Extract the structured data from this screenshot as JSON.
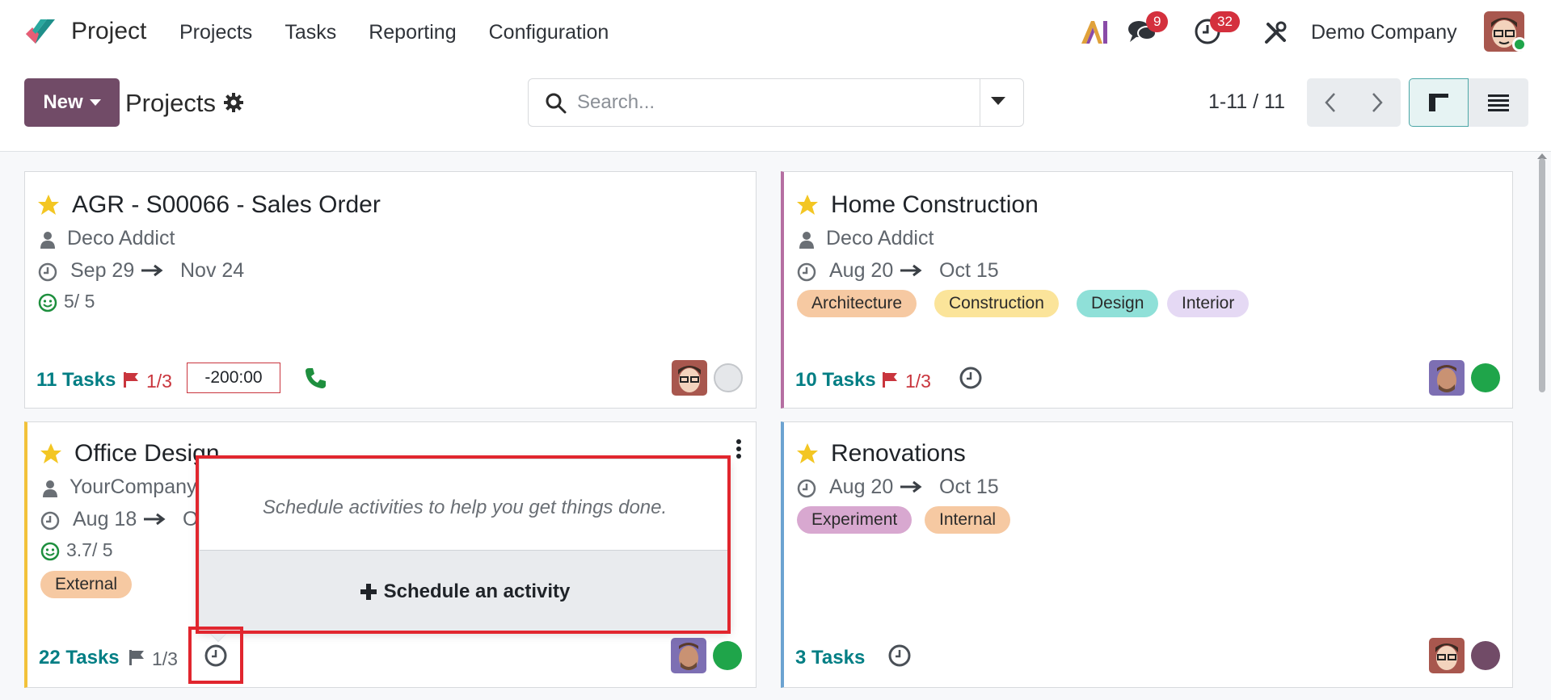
{
  "app": {
    "name": "Project"
  },
  "nav": {
    "items": [
      "Projects",
      "Tasks",
      "Reporting",
      "Configuration"
    ]
  },
  "systray": {
    "ai_label": "AI",
    "messages_count": "9",
    "activities_count": "32",
    "company": "Demo Company"
  },
  "control": {
    "new_label": "New",
    "breadcrumb": "Projects",
    "search_placeholder": "Search...",
    "pager": "1-11 / 11"
  },
  "cards": [
    {
      "title": "AGR - S00066 - Sales Order",
      "customer": "Deco Addict",
      "date_start": "Sep 29",
      "date_end": "Nov 24",
      "rating": "5/ 5",
      "tasks_count": "11",
      "tasks_label": "Tasks",
      "milestones": "1/3",
      "hours": "-200:00"
    },
    {
      "title": "Home Construction",
      "customer": "Deco Addict",
      "date_start": "Aug 20",
      "date_end": "Oct 15",
      "tags": [
        "Architecture",
        "Construction",
        "Design",
        "Interior"
      ],
      "tasks_count": "10",
      "tasks_label": "Tasks",
      "milestones": "1/3"
    },
    {
      "title": "Office Design",
      "customer": "YourCompany",
      "date_start": "Aug 18",
      "date_end": "O",
      "rating": "3.7/ 5",
      "tags": [
        "External"
      ],
      "tasks_count": "22",
      "tasks_label": "Tasks",
      "milestones": "1/3"
    },
    {
      "title": "Renovations",
      "date_start": "Aug 20",
      "date_end": "Oct 15",
      "tags": [
        "Experiment",
        "Internal"
      ],
      "tasks_count": "3",
      "tasks_label": "Tasks"
    }
  ],
  "popover": {
    "message": "Schedule activities to help you get things done.",
    "action_label": "Schedule an activity"
  },
  "colors": {
    "brand": "#714b67",
    "teal": "#017e84",
    "tag_architecture": "#f6c9a2",
    "tag_construction": "#fbe49a",
    "tag_design": "#8fe0d8",
    "tag_interior": "#e5d9f4",
    "tag_external": "#f6c9a2",
    "tag_experiment": "#d8a8d0",
    "tag_internal": "#f6c9a2"
  }
}
